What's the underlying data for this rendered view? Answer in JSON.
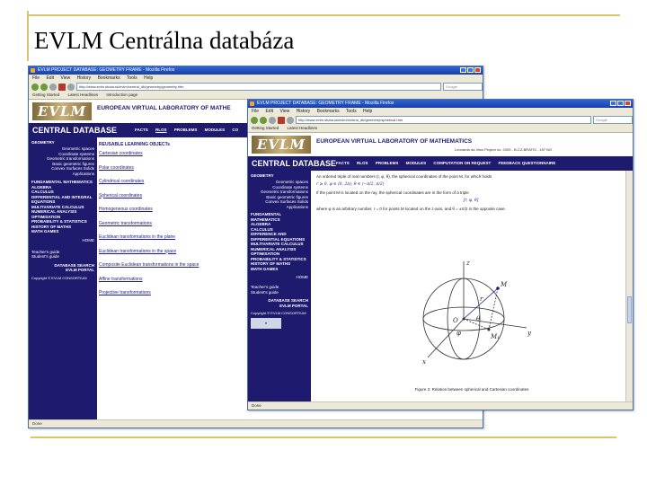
{
  "slide": {
    "title": "EVLM Centrálna databáza"
  },
  "windowA": {
    "title": "EVLM PROJECT DATABASE: GEOMETRY FRAME - Mozilla Firefox",
    "menu": [
      "File",
      "Edit",
      "View",
      "History",
      "Bookmarks",
      "Tools",
      "Help"
    ],
    "url": "http://www.evlm.stuba.sk/evlm/central_db/geometry/geometry.htm",
    "search_placeholder": "Google",
    "bookmarks": [
      "Getting Started",
      "Latest Headlines",
      "Introduction page"
    ],
    "banner": "EUROPEAN VIRTUAL LABORATORY OF MATHE",
    "central": "CENTRAL DATABASE",
    "nav": [
      "FACTS",
      "RLOS",
      "PROBLEMS",
      "MODULES",
      "CO"
    ],
    "sidebar": {
      "section": "GEOMETRY",
      "subitems": [
        "Geometric spaces",
        "Coordinate systems",
        "Geometric transformations",
        "Basic geometric figures",
        "Convex Surfaces Solids",
        "Applications"
      ],
      "items": [
        "FUNDAMENTAL MATHEMATICS",
        "ALGEBRA",
        "CALCULUS",
        "DIFFERENTIAL AND INTEGRAL EQUATIONS",
        "MULTIVARIATE CALCULUS",
        "NUMERICAL ANALYSIS",
        "OPTIMISATION",
        "PROBABILITY & STATISTICS",
        "HISTORY OF MATHS",
        "MATH GAMES"
      ],
      "home": "HOME",
      "guides": [
        "Teacher's guide",
        "Student's guide"
      ],
      "footer": [
        "DATABASE SEARCH",
        "EVLM PORTAL"
      ],
      "copyright": "Copyright © EVLM CONSORTIUM"
    },
    "main": {
      "heading": "REUSABLE LEARNING OBJECTs",
      "links": [
        "Cartesian coordinates",
        "Polar coordinates",
        "Cylindrical coordinates",
        "Spherical coordinates",
        "Homogeneous coordinates",
        "Geometric transformations",
        "Euclidean transformations in the plane",
        "Euclidean transformations in the space",
        "Composite Euclidean transformations in the space",
        "Affine transformations",
        "Projective transformations"
      ]
    },
    "status": "Done"
  },
  "windowB": {
    "title": "EVLM PROJECT DATABASE: GEOMETRY FRAME - Mozilla Firefox",
    "url": "http://www.evlm.stuba.sk/evlm/central_db/geometry/spherical.htm",
    "bookmarks": [
      "Getting Started",
      "Latest Headlines"
    ],
    "banner": "EUROPEAN VIRTUAL LABORATORY OF MATHEMATICS",
    "sub_banner": "Leonardo da Vinci Project no. 2005 - B-CZ-BRATIS - 157 NO",
    "central": "CENTRAL DATABASE",
    "nav": [
      "FACTS",
      "RLOS",
      "PROBLEMS",
      "MODULES",
      "COMPUTATION ON REQUEST",
      "FEEDBACK QUESTIONNAIRE"
    ],
    "sidebar": {
      "section": "GEOMETRY",
      "subitems": [
        "Geometric spaces",
        "Coordinate systems",
        "Geometric transformations",
        "Basic geometric figures",
        "Convex Surfaces Solids",
        "Applications"
      ],
      "items": [
        "FUNDAMENTAL MATHEMATICS",
        "ALGEBRA",
        "CALCULUS",
        "DIFFERENCE AND DIFFERENTIAL EQUATIONS",
        "MULTIVARIATE CALCULUS",
        "NUMERICAL ANALYSIS",
        "OPTIMISATION",
        "PROBABILITY & STATISTICS",
        "HISTORY OF MATHS",
        "MATH GAMES"
      ],
      "home": "HOME",
      "guides": [
        "Teacher's guide",
        "Student's guide"
      ],
      "footer": [
        "DATABASE SEARCH",
        "EVLM PORTAL"
      ],
      "copyright": "Copyright © EVLM CONSORTIUM"
    },
    "main": {
      "p1": "An ordered triple of real numbers (r, φ, θ), the spherical coordinates of the point M, for which holds",
      "f1": "r ≥ 0,   φ ∈ ⟨0, 2π),   θ ∈ ⟨−π/2, π/2⟩",
      "p2": "If the point M is located on the ray, the spherical coordinates are in the form of a triple",
      "f2": "[r, φ, θ]",
      "p3": "where φ is an arbitrary number, r = 0 for points M located on the z-axis, and θ = ±π/2 in the opposite case.",
      "caption": "Figure 2: Relation between spherical and Cartesian coordinates",
      "figure_labels": [
        "z",
        "M",
        "r",
        "O",
        "θ",
        "φ",
        "x",
        "y",
        "M₁"
      ]
    },
    "status": "Done"
  }
}
